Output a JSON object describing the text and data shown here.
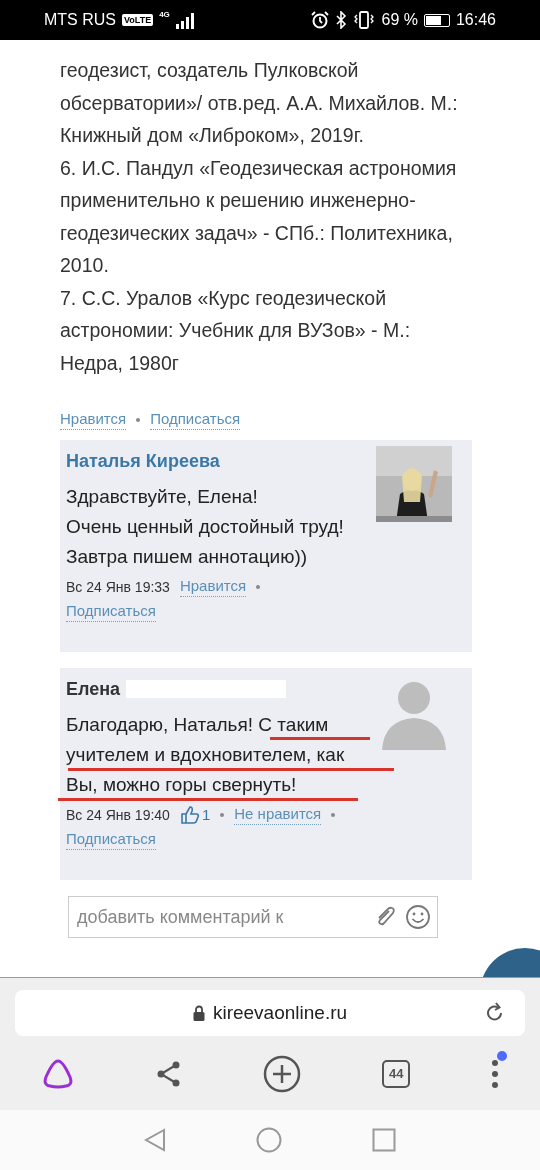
{
  "status_bar": {
    "carrier": "MTS RUS",
    "volte": "VoLTE",
    "network": "4G",
    "battery": "69 %",
    "time": "16:46"
  },
  "article": {
    "paragraphs": [
      "геодезист, создатель Пулковской обсерватории»/ отв.ред. А.А. Михайлов. М.: Книжный дом «Либроком», 2019г.",
      "6. И.С. Пандул «Геодезическая астрономия применительно к решению инженерно-геодезических задач» - СПб.: Политехника, 2010.",
      "7. С.С. Уралов «Курс геодезической астрономии: Учебник для ВУЗов» - М.: Недра, 1980г"
    ]
  },
  "post_actions": [
    "Нравится",
    "Подписаться"
  ],
  "comments": [
    {
      "author": "Наталья Киреева",
      "highlighted": true,
      "redacted": false,
      "photo": true,
      "text": "Здравствуйте, Елена!\nОчень ценный достойный труд!\nЗавтра пишем аннотацию))",
      "underlined": false,
      "time": "Вс 24 Янв 19:33",
      "actions": [
        "Нравится",
        "Подписаться"
      ]
    },
    {
      "author": "Елена",
      "highlighted": false,
      "redacted": true,
      "photo": false,
      "text": "Благодарю, Наталья! С таким\nучителем и вдохновителем, как\nВы, можно горы свернуть!",
      "underlined": true,
      "time": "Вс 24 Янв 19:40",
      "like_count": "1",
      "actions": [
        "Не нравится",
        "Подписаться"
      ]
    }
  ],
  "comment_input": {
    "placeholder": "добавить комментарий к"
  },
  "browser": {
    "url": "kireevaonline.ru",
    "tab_count": "44",
    "menu_badge": true
  }
}
